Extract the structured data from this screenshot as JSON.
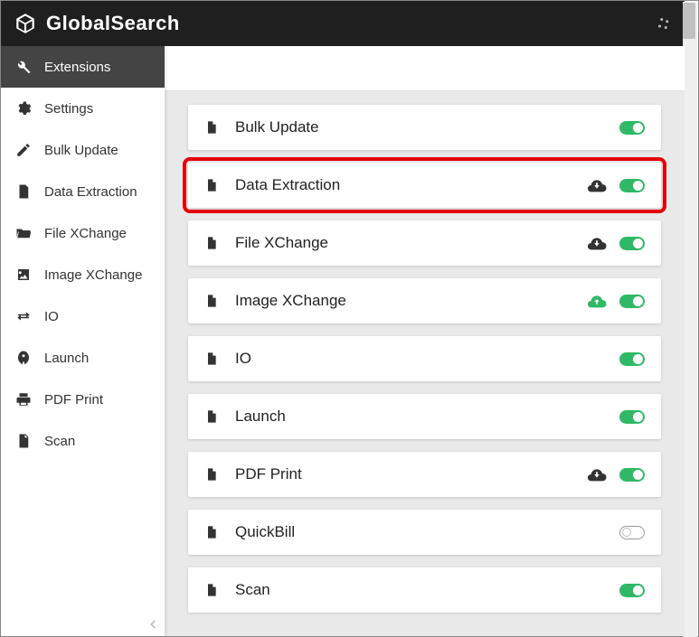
{
  "header": {
    "title": "GlobalSearch"
  },
  "sidebar": {
    "items": [
      {
        "label": "Extensions",
        "icon": "wrench",
        "active": true
      },
      {
        "label": "Settings",
        "icon": "gear",
        "active": false
      },
      {
        "label": "Bulk Update",
        "icon": "edit",
        "active": false
      },
      {
        "label": "Data Extraction",
        "icon": "doc-lines",
        "active": false
      },
      {
        "label": "File XChange",
        "icon": "folder-open",
        "active": false
      },
      {
        "label": "Image XChange",
        "icon": "image",
        "active": false
      },
      {
        "label": "IO",
        "icon": "transfer",
        "active": false
      },
      {
        "label": "Launch",
        "icon": "rocket",
        "active": false
      },
      {
        "label": "PDF Print",
        "icon": "print",
        "active": false
      },
      {
        "label": "Scan",
        "icon": "doc",
        "active": false
      }
    ]
  },
  "extensions": [
    {
      "label": "Bulk Update",
      "cloud": null,
      "enabled": true,
      "highlighted": false
    },
    {
      "label": "Data Extraction",
      "cloud": "cloud-dark",
      "enabled": true,
      "highlighted": true
    },
    {
      "label": "File XChange",
      "cloud": "cloud-dark",
      "enabled": true,
      "highlighted": false
    },
    {
      "label": "Image XChange",
      "cloud": "cloud-green",
      "enabled": true,
      "highlighted": false
    },
    {
      "label": "IO",
      "cloud": null,
      "enabled": true,
      "highlighted": false
    },
    {
      "label": "Launch",
      "cloud": null,
      "enabled": true,
      "highlighted": false
    },
    {
      "label": "PDF Print",
      "cloud": "cloud-dark",
      "enabled": true,
      "highlighted": false
    },
    {
      "label": "QuickBill",
      "cloud": null,
      "enabled": false,
      "highlighted": false
    },
    {
      "label": "Scan",
      "cloud": null,
      "enabled": true,
      "highlighted": false
    }
  ]
}
